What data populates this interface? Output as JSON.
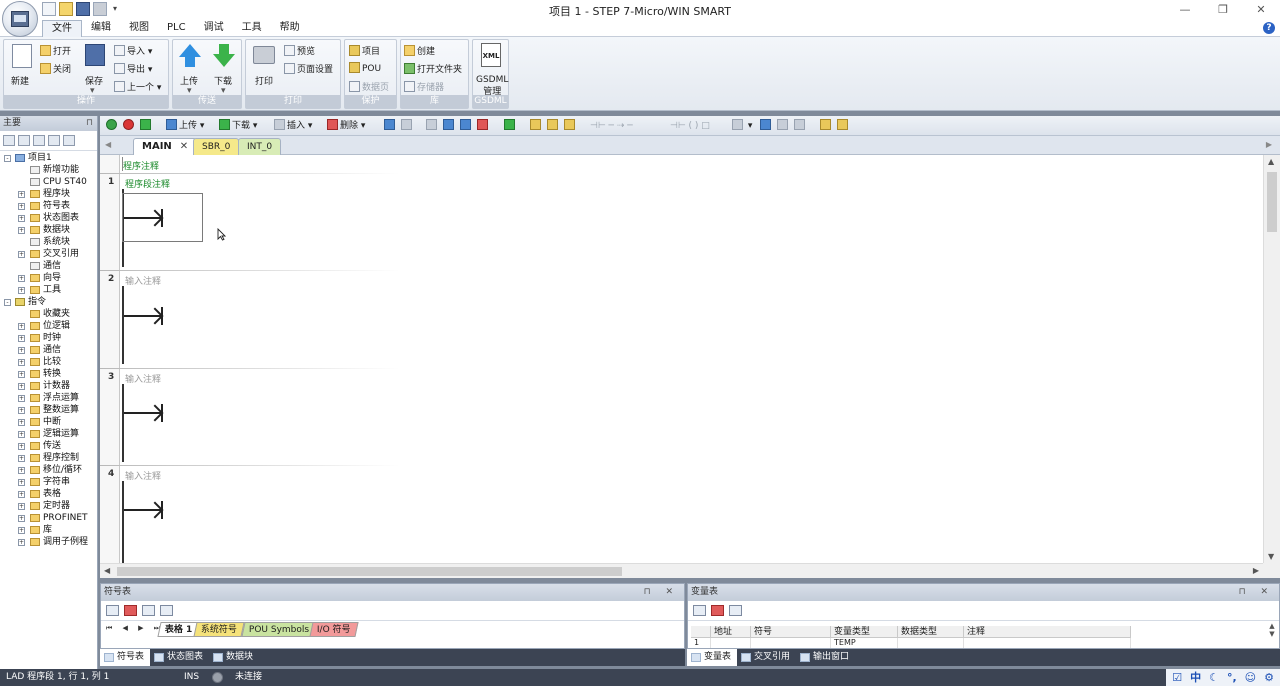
{
  "window": {
    "title": "项目 1 - STEP 7-Micro/WIN SMART",
    "minimize": "—",
    "restore": "❐",
    "close": "✕"
  },
  "menu": {
    "tabs": [
      "文件",
      "编辑",
      "视图",
      "PLC",
      "调试",
      "工具",
      "帮助"
    ],
    "active": "文件",
    "help": "?"
  },
  "ribbon": {
    "operate": {
      "label": "操作",
      "new": "新建",
      "open": "打开",
      "close": "关闭",
      "save": "保存",
      "import": "导入",
      "export": "导出",
      "previous": "上一个"
    },
    "transfer": {
      "label": "传送",
      "upload": "上传",
      "download": "下载"
    },
    "print": {
      "label": "打印",
      "print": "打印",
      "preview": "预览",
      "page_setup": "页面设置"
    },
    "protect": {
      "label": "保护",
      "project": "项目",
      "pou": "POU",
      "data_page": "数据页"
    },
    "library": {
      "label": "库",
      "create": "创建",
      "open_folder": "打开文件夹",
      "memory": "存储器"
    },
    "gsdml": {
      "label": "GSDML",
      "button": "GSDML\n管理",
      "icon_text": "XML"
    }
  },
  "left_panel": {
    "title": "主要",
    "pin": "⊓",
    "tree": [
      {
        "label": "项目1",
        "level": 0,
        "exp": "-",
        "icon": "proj"
      },
      {
        "label": "新增功能",
        "level": 1,
        "exp": "",
        "icon": "file"
      },
      {
        "label": "CPU ST40",
        "level": 1,
        "exp": "",
        "icon": "file"
      },
      {
        "label": "程序块",
        "level": 1,
        "exp": "+",
        "icon": "folder"
      },
      {
        "label": "符号表",
        "level": 1,
        "exp": "+",
        "icon": "folder"
      },
      {
        "label": "状态图表",
        "level": 1,
        "exp": "+",
        "icon": "folder"
      },
      {
        "label": "数据块",
        "level": 1,
        "exp": "+",
        "icon": "folder"
      },
      {
        "label": "系统块",
        "level": 1,
        "exp": "",
        "icon": "file"
      },
      {
        "label": "交叉引用",
        "level": 1,
        "exp": "+",
        "icon": "folder"
      },
      {
        "label": "通信",
        "level": 1,
        "exp": "",
        "icon": "file"
      },
      {
        "label": "向导",
        "level": 1,
        "exp": "+",
        "icon": "folder"
      },
      {
        "label": "工具",
        "level": 1,
        "exp": "+",
        "icon": "folder"
      },
      {
        "label": "指令",
        "level": 0,
        "exp": "-",
        "icon": "instr"
      },
      {
        "label": "收藏夹",
        "level": 1,
        "exp": "",
        "icon": "folder"
      },
      {
        "label": "位逻辑",
        "level": 1,
        "exp": "+",
        "icon": "folder"
      },
      {
        "label": "时钟",
        "level": 1,
        "exp": "+",
        "icon": "folder"
      },
      {
        "label": "通信",
        "level": 1,
        "exp": "+",
        "icon": "folder"
      },
      {
        "label": "比较",
        "level": 1,
        "exp": "+",
        "icon": "folder"
      },
      {
        "label": "转换",
        "level": 1,
        "exp": "+",
        "icon": "folder"
      },
      {
        "label": "计数器",
        "level": 1,
        "exp": "+",
        "icon": "folder"
      },
      {
        "label": "浮点运算",
        "level": 1,
        "exp": "+",
        "icon": "folder"
      },
      {
        "label": "整数运算",
        "level": 1,
        "exp": "+",
        "icon": "folder"
      },
      {
        "label": "中断",
        "level": 1,
        "exp": "+",
        "icon": "folder"
      },
      {
        "label": "逻辑运算",
        "level": 1,
        "exp": "+",
        "icon": "folder"
      },
      {
        "label": "传送",
        "level": 1,
        "exp": "+",
        "icon": "folder"
      },
      {
        "label": "程序控制",
        "level": 1,
        "exp": "+",
        "icon": "folder"
      },
      {
        "label": "移位/循环",
        "level": 1,
        "exp": "+",
        "icon": "folder"
      },
      {
        "label": "字符串",
        "level": 1,
        "exp": "+",
        "icon": "folder"
      },
      {
        "label": "表格",
        "level": 1,
        "exp": "+",
        "icon": "folder"
      },
      {
        "label": "定时器",
        "level": 1,
        "exp": "+",
        "icon": "folder"
      },
      {
        "label": "PROFINET",
        "level": 1,
        "exp": "+",
        "icon": "folder"
      },
      {
        "label": "库",
        "level": 1,
        "exp": "+",
        "icon": "folder"
      },
      {
        "label": "调用子例程",
        "level": 1,
        "exp": "+",
        "icon": "folder"
      }
    ]
  },
  "editor_toolbar": {
    "upload": "上传",
    "download": "下载",
    "insert": "插入",
    "delete": "删除"
  },
  "pou_tabs": {
    "main": "MAIN",
    "sbr": "SBR_0",
    "int": "INT_0",
    "close": "✕",
    "left": "◀",
    "right": "▶"
  },
  "ladder": {
    "program_comment": "程序注释",
    "networks": [
      {
        "number": "1",
        "comment": "程序段注释"
      },
      {
        "number": "2",
        "comment": "输入注释"
      },
      {
        "number": "3",
        "comment": "输入注释"
      },
      {
        "number": "4",
        "comment": "输入注释"
      }
    ]
  },
  "symbol_panel": {
    "title": "符号表",
    "pins": "⊓ ✕",
    "nav": "⏮ ◀ ▶ ⏭",
    "tabs": [
      "表格 1",
      "系统符号",
      "POU Symbols",
      "I/O 符号"
    ]
  },
  "variable_panel": {
    "title": "变量表",
    "pins": "⊓ ✕",
    "columns": [
      "",
      "地址",
      "符号",
      "变量类型",
      "数据类型",
      "注释"
    ],
    "row": {
      "num": "1",
      "address": "",
      "symbol": "",
      "var_type": "TEMP",
      "data_type": "",
      "comment": ""
    },
    "scroll_up": "▲",
    "scroll_down": "▼"
  },
  "bottom_tabs_left": [
    "符号表",
    "状态图表",
    "数据块"
  ],
  "bottom_tabs_right": [
    "变量表",
    "交叉引用",
    "输出窗口"
  ],
  "statusbar": {
    "position": "LAD 程序段 1, 行 1, 列 1",
    "mode": "INS",
    "connection": "未连接"
  },
  "tray": [
    "☑",
    "中",
    "☾",
    "°,",
    "☺",
    "⚙"
  ]
}
